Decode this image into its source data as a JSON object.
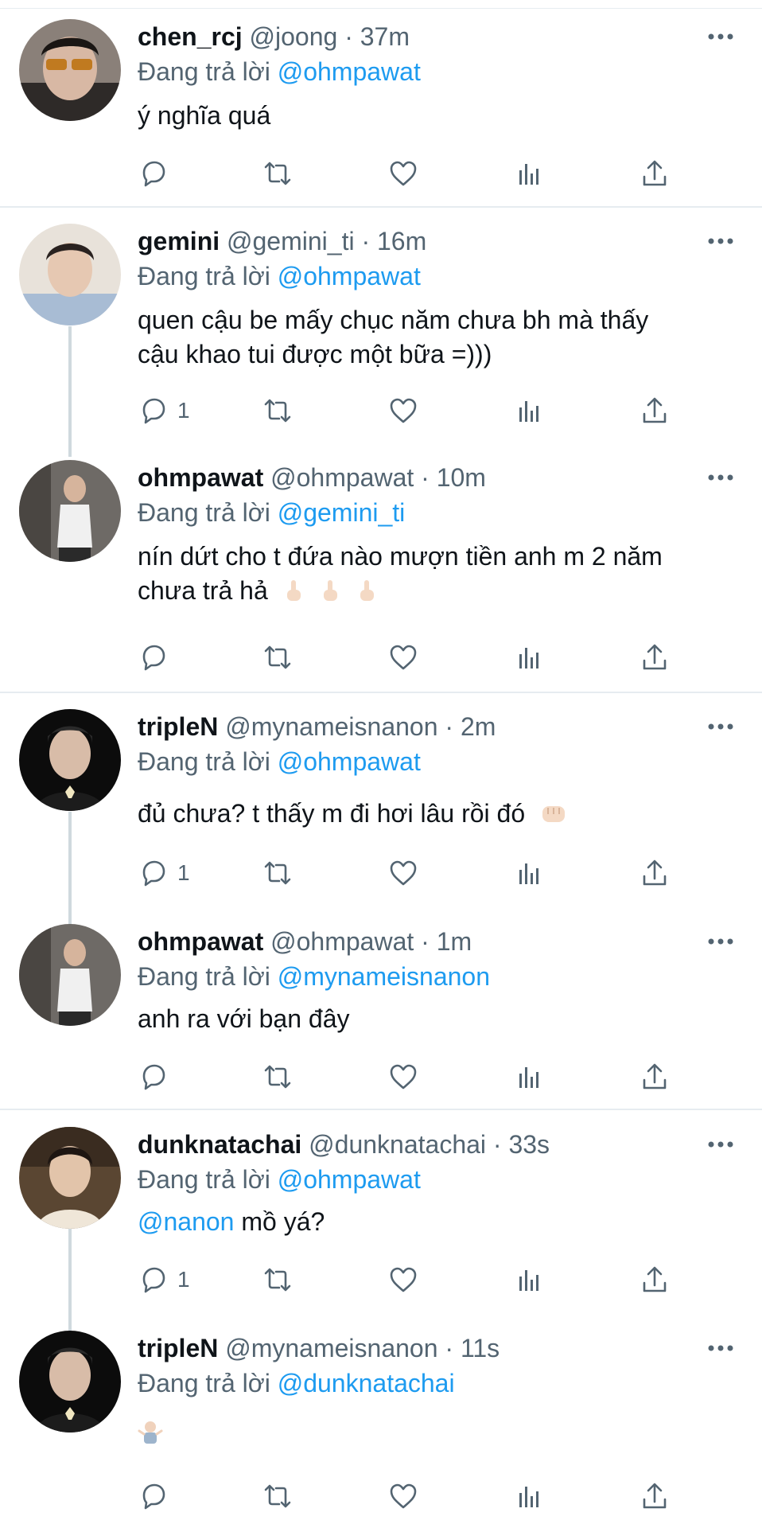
{
  "tweets": [
    {
      "name": "chen_rcj",
      "handle": "@joong",
      "time": "37m",
      "replying": "Đang trả lời",
      "reply_to": "@ohmpawat",
      "text": "ý nghĩa quá",
      "replies": ""
    },
    {
      "name": "gemini",
      "handle": "@gemini_ti",
      "time": "16m",
      "replying": "Đang trả lời",
      "reply_to": "@ohmpawat",
      "text_line1": "quen cậu be mấy chục năm chưa bh mà thấy",
      "text_line2": "cậu khao tui được một bữa =)))",
      "replies": "1"
    },
    {
      "name": "ohmpawat",
      "handle": "@ohmpawat",
      "time": "10m",
      "replying": "Đang trả lời",
      "reply_to": "@gemini_ti",
      "text_line1": "nín dứt cho t đứa nào mượn tiền anh m 2 năm",
      "text_line2": "chưa trả hả",
      "replies": ""
    },
    {
      "name": "tripleN",
      "handle": "@mynameisnanon",
      "time": "2m",
      "replying": "Đang trả lời",
      "reply_to": "@ohmpawat",
      "text": "đủ chưa? t thấy m đi hơi lâu rồi đó",
      "replies": "1"
    },
    {
      "name": "ohmpawat",
      "handle": "@ohmpawat",
      "time": "1m",
      "replying": "Đang trả lời",
      "reply_to": "@mynameisnanon",
      "text": "anh ra với bạn đây",
      "replies": ""
    },
    {
      "name": "dunknatachai",
      "handle": "@dunknatachai",
      "time": "33s",
      "replying": "Đang trả lời",
      "reply_to": "@ohmpawat",
      "mention": "@nanon",
      "text": "mồ yá?",
      "replies": "1"
    },
    {
      "name": "tripleN",
      "handle": "@mynameisnanon",
      "time": "11s",
      "replying": "Đang trả lời",
      "reply_to": "@dunknatachai",
      "text": "",
      "replies": ""
    }
  ],
  "separator": " · ",
  "icons": {
    "reply": "reply-icon",
    "retweet": "retweet-icon",
    "like": "like-icon",
    "views": "views-icon",
    "share": "share-icon",
    "more": "more-icon"
  },
  "colors": {
    "link": "#1d9bf0",
    "secondary": "#536471",
    "divider": "#e6ecf0"
  }
}
